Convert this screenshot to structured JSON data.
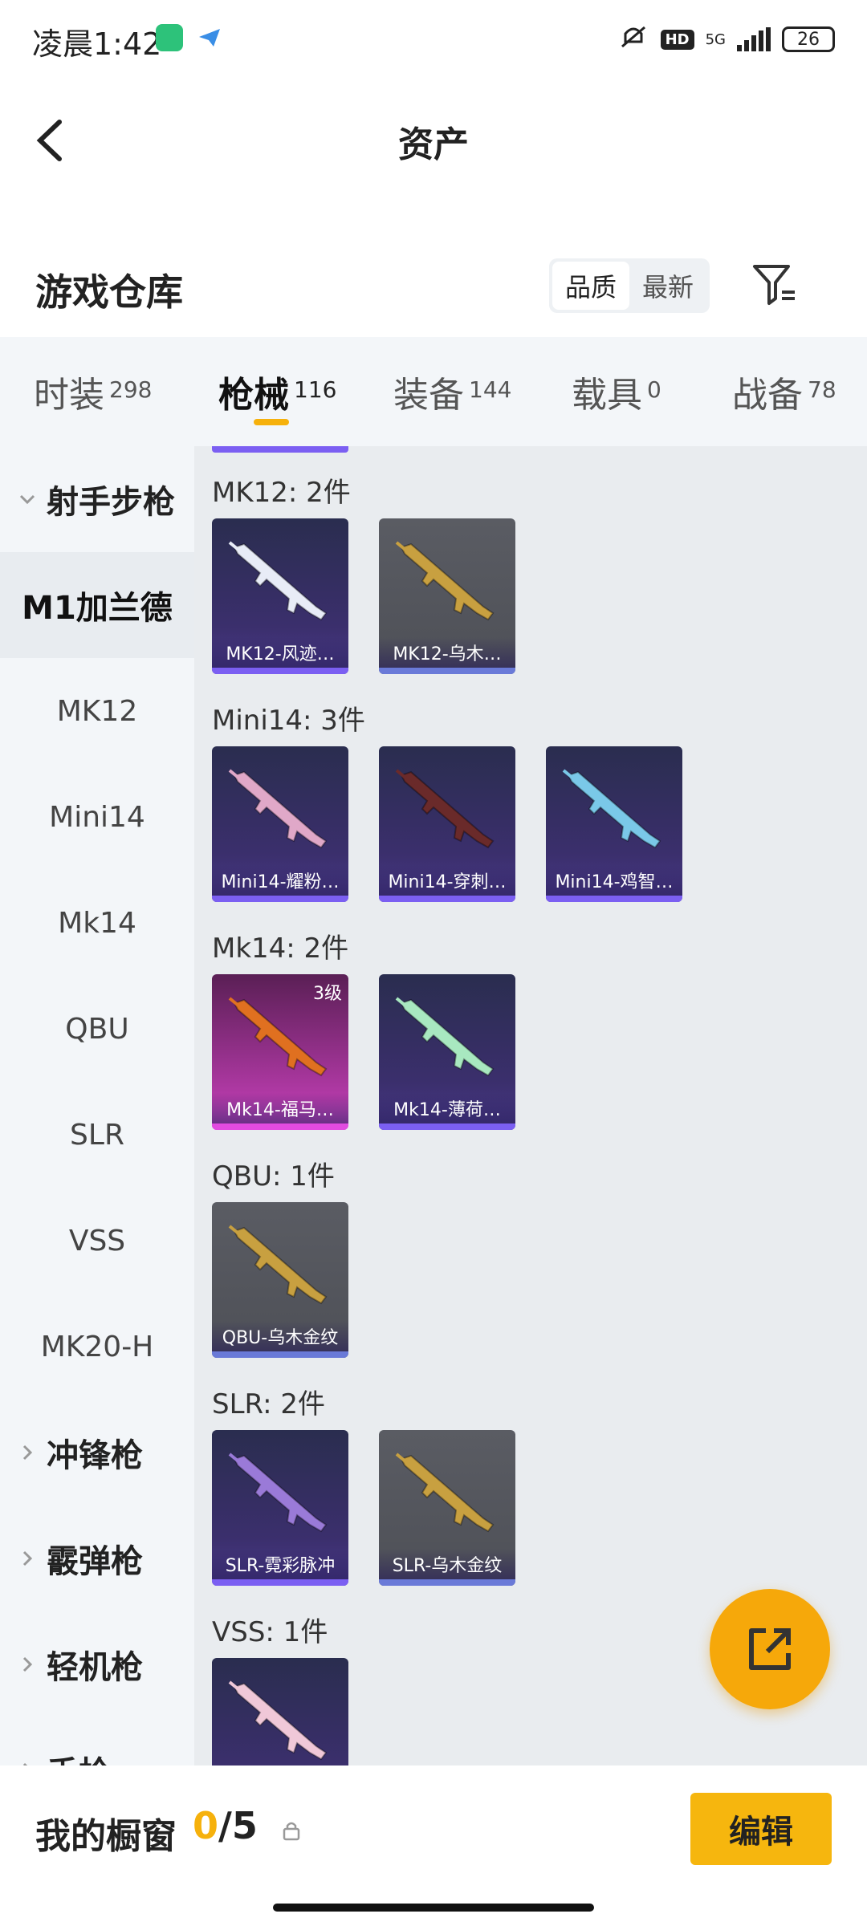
{
  "status": {
    "time": "凌晨1:42",
    "network": "5G",
    "hd": "HD",
    "battery": "26"
  },
  "header": {
    "title": "资产"
  },
  "section": {
    "label": "游戏仓库",
    "sort_options": [
      "品质",
      "最新"
    ],
    "sort_selected": "品质"
  },
  "tabs": [
    {
      "label": "时装",
      "count": "298"
    },
    {
      "label": "枪械",
      "count": "116",
      "active": true
    },
    {
      "label": "装备",
      "count": "144"
    },
    {
      "label": "载具",
      "count": "0"
    },
    {
      "label": "战备",
      "count": "78"
    }
  ],
  "sidebar": {
    "groups": [
      "射手步枪",
      "冲锋枪",
      "霰弹枪",
      "轻机枪",
      "手枪"
    ],
    "items": [
      "M1加兰德",
      "MK12",
      "Mini14",
      "Mk14",
      "QBU",
      "SLR",
      "VSS",
      "MK20-H"
    ],
    "selected": "M1加兰德"
  },
  "content": {
    "categories": [
      {
        "title": "MK12: 2件",
        "cards": [
          {
            "name": "MK12-风迹…",
            "style": "purple",
            "gun_color": "#e8ecf7"
          },
          {
            "name": "MK12-乌木…",
            "style": "gray",
            "gun_color": "#c8a040"
          }
        ]
      },
      {
        "title": "Mini14: 3件",
        "cards": [
          {
            "name": "Mini14-耀粉…",
            "style": "purple",
            "gun_color": "#e0a8c8"
          },
          {
            "name": "Mini14-穿刺…",
            "style": "purple",
            "gun_color": "#6a2a2a"
          },
          {
            "name": "Mini14-鸡智…",
            "style": "purple",
            "gun_color": "#7ac8e8"
          }
        ]
      },
      {
        "title": "Mk14: 2件",
        "cards": [
          {
            "name": "Mk14-福马…",
            "style": "pink",
            "gun_color": "#e07020",
            "level": "3级"
          },
          {
            "name": "Mk14-薄荷…",
            "style": "purple",
            "gun_color": "#a8e8c0"
          }
        ]
      },
      {
        "title": "QBU: 1件",
        "cards": [
          {
            "name": "QBU-乌木金纹",
            "style": "gray",
            "gun_color": "#c8a040"
          }
        ]
      },
      {
        "title": "SLR: 2件",
        "cards": [
          {
            "name": "SLR-霓彩脉冲",
            "style": "purple",
            "gun_color": "#9a7ad8"
          },
          {
            "name": "SLR-乌木金纹",
            "style": "gray",
            "gun_color": "#c8a040"
          }
        ]
      },
      {
        "title": "VSS: 1件",
        "cards": [
          {
            "name": "",
            "style": "purple",
            "gun_color": "#f0c8d8"
          }
        ]
      }
    ]
  },
  "bottom": {
    "label": "我的橱窗",
    "count_current": "0",
    "count_sep": "/",
    "count_total": "5",
    "edit_label": "编辑"
  },
  "colors": {
    "accent": "#f6b10c",
    "fab": "#f6a80a"
  }
}
